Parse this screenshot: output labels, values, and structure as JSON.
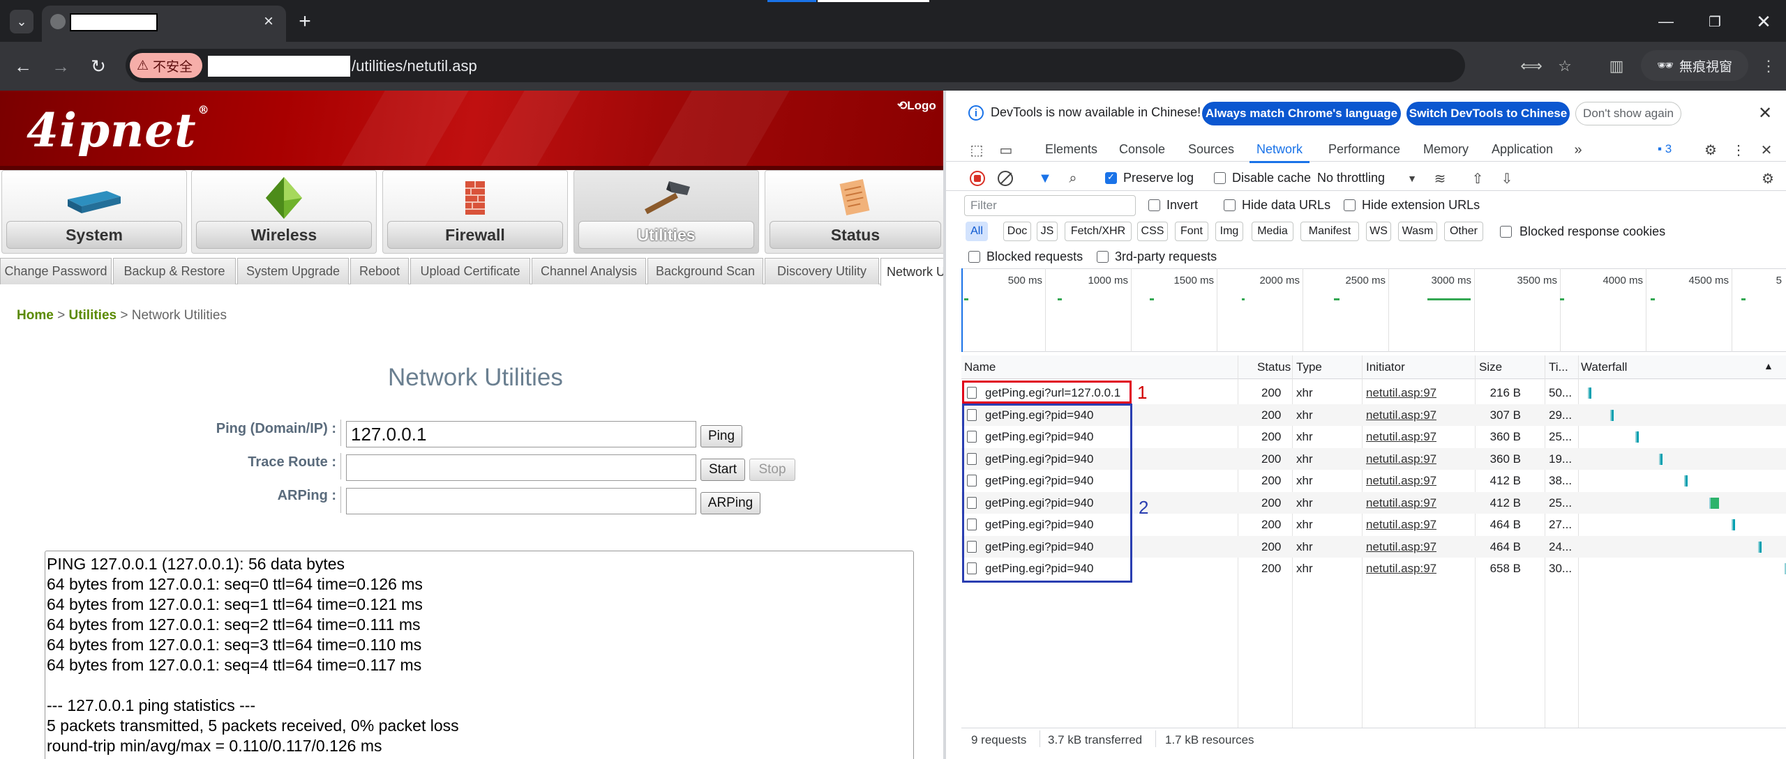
{
  "browser": {
    "address_suffix": "/utilities/netutil.asp",
    "insecure_label": "不安全",
    "incognito_label": "無痕視窗"
  },
  "page": {
    "logo": "4ipnet",
    "logout": "Logo",
    "main_tabs": [
      {
        "label": "System",
        "icon": "router-icon"
      },
      {
        "label": "Wireless",
        "icon": "wireless-diamond-icon"
      },
      {
        "label": "Firewall",
        "icon": "firewall-brick-icon"
      },
      {
        "label": "Utilities",
        "icon": "hammer-icon",
        "active": true
      },
      {
        "label": "Status",
        "icon": "status-doc-icon"
      }
    ],
    "sub_tabs": [
      "Change Password",
      "Backup & Restore",
      "System Upgrade",
      "Reboot",
      "Upload Certificate",
      "Channel Analysis",
      "Background Scan",
      "Discovery Utility",
      "Network U"
    ],
    "breadcrumb": {
      "home": "Home",
      "sep1": ">",
      "utilities": "Utilities",
      "sep2": ">",
      "current": "Network Utilities"
    },
    "title": "Network Utilities",
    "form": {
      "ping_label": "Ping (Domain/IP) :",
      "ping_value": "127.0.0.1",
      "ping_button": "Ping",
      "trace_label": "Trace Route :",
      "trace_value": "",
      "start_button": "Start",
      "stop_button": "Stop",
      "arping_label": "ARPing :",
      "arping_value": "",
      "arping_button": "ARPing"
    },
    "output_lines": [
      "PING 127.0.0.1 (127.0.0.1): 56 data bytes",
      "64 bytes from 127.0.0.1: seq=0 ttl=64 time=0.126 ms",
      "64 bytes from 127.0.0.1: seq=1 ttl=64 time=0.121 ms",
      "64 bytes from 127.0.0.1: seq=2 ttl=64 time=0.111 ms",
      "64 bytes from 127.0.0.1: seq=3 ttl=64 time=0.110 ms",
      "64 bytes from 127.0.0.1: seq=4 ttl=64 time=0.117 ms",
      "",
      "--- 127.0.0.1 ping statistics ---",
      "5 packets transmitted, 5 packets received, 0% packet loss",
      "round-trip min/avg/max = 0.110/0.117/0.126 ms"
    ]
  },
  "devtools": {
    "infobar": {
      "text": "DevTools is now available in Chinese!",
      "btn_match": "Always match Chrome's language",
      "btn_switch": "Switch DevTools to Chinese",
      "btn_dismiss": "Don't show again"
    },
    "tabs": [
      "Elements",
      "Console",
      "Sources",
      "Network",
      "Performance",
      "Memory",
      "Application"
    ],
    "active_tab": "Network",
    "issues_count": "3",
    "toolbar": {
      "preserve_log": "Preserve log",
      "disable_cache": "Disable cache",
      "throttling": "No throttling"
    },
    "filter": {
      "placeholder": "Filter",
      "invert": "Invert",
      "hide_data_urls": "Hide data URLs",
      "hide_extension_urls": "Hide extension URLs",
      "types": [
        "All",
        "Doc",
        "JS",
        "Fetch/XHR",
        "CSS",
        "Font",
        "Img",
        "Media",
        "Manifest",
        "WS",
        "Wasm",
        "Other"
      ],
      "blocked_response_cookies": "Blocked response cookies",
      "blocked_requests": "Blocked requests",
      "third_party": "3rd-party requests"
    },
    "overview_ticks": [
      "500 ms",
      "1000 ms",
      "1500 ms",
      "2000 ms",
      "2500 ms",
      "3000 ms",
      "3500 ms",
      "4000 ms",
      "4500 ms",
      "5"
    ],
    "columns": {
      "name": "Name",
      "status": "Status",
      "type": "Type",
      "initiator": "Initiator",
      "size": "Size",
      "time": "Ti...",
      "waterfall": "Waterfall"
    },
    "requests": [
      {
        "name": "getPing.egi?url=127.0.0.1",
        "status": "200",
        "type": "xhr",
        "initiator": "netutil.asp:97",
        "size": "216 B",
        "time": "50..."
      },
      {
        "name": "getPing.egi?pid=940",
        "status": "200",
        "type": "xhr",
        "initiator": "netutil.asp:97",
        "size": "307 B",
        "time": "29..."
      },
      {
        "name": "getPing.egi?pid=940",
        "status": "200",
        "type": "xhr",
        "initiator": "netutil.asp:97",
        "size": "360 B",
        "time": "25..."
      },
      {
        "name": "getPing.egi?pid=940",
        "status": "200",
        "type": "xhr",
        "initiator": "netutil.asp:97",
        "size": "360 B",
        "time": "19..."
      },
      {
        "name": "getPing.egi?pid=940",
        "status": "200",
        "type": "xhr",
        "initiator": "netutil.asp:97",
        "size": "412 B",
        "time": "38..."
      },
      {
        "name": "getPing.egi?pid=940",
        "status": "200",
        "type": "xhr",
        "initiator": "netutil.asp:97",
        "size": "412 B",
        "time": "25..."
      },
      {
        "name": "getPing.egi?pid=940",
        "status": "200",
        "type": "xhr",
        "initiator": "netutil.asp:97",
        "size": "464 B",
        "time": "27..."
      },
      {
        "name": "getPing.egi?pid=940",
        "status": "200",
        "type": "xhr",
        "initiator": "netutil.asp:97",
        "size": "464 B",
        "time": "24..."
      },
      {
        "name": "getPing.egi?pid=940",
        "status": "200",
        "type": "xhr",
        "initiator": "netutil.asp:97",
        "size": "658 B",
        "time": "30..."
      }
    ],
    "annotations": {
      "red": "1",
      "blue": "2"
    },
    "status_bar": {
      "requests": "9 requests",
      "transferred": "3.7 kB transferred",
      "resources": "1.7 kB resources"
    }
  },
  "colors": {
    "header_red": "#a80000",
    "devtools_accent": "#1a73e8",
    "annotation_red": "#e0001b",
    "annotation_blue": "#2a3eb1"
  }
}
